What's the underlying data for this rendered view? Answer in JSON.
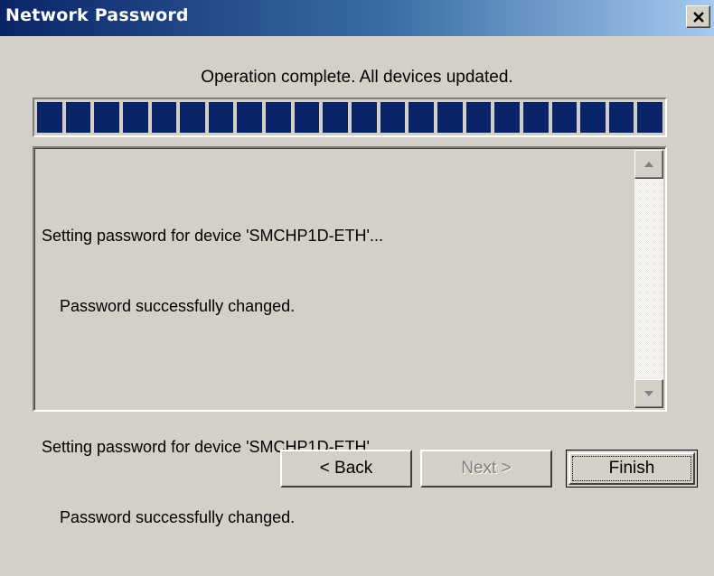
{
  "window": {
    "title": "Network Password",
    "close_icon": "close-icon"
  },
  "status": {
    "text": "Operation complete. All devices updated.",
    "progress_fraction": 1.0,
    "segment_count": 22,
    "bar_color": "#0a246a"
  },
  "log": {
    "lines": [
      "Setting password for device 'SMCHP1D-ETH'...",
      "    Password successfully changed.",
      "",
      "Setting password for device 'SMCHP1D-ETH'...",
      "    Password successfully changed."
    ],
    "scroll_up_icon": "scroll-up-arrow-icon",
    "scroll_down_icon": "scroll-down-arrow-icon"
  },
  "buttons": {
    "back": "< Back",
    "next": "Next >",
    "finish": "Finish",
    "next_enabled": false
  }
}
